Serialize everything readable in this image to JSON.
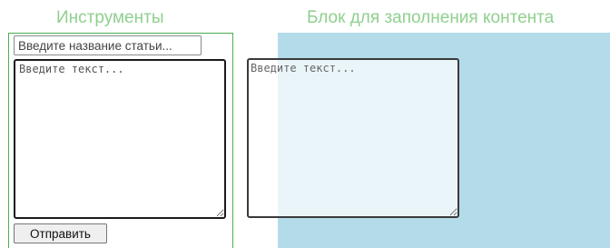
{
  "tools": {
    "heading": "Инструменты",
    "title_placeholder": "Введите название статьи...",
    "text_placeholder": "Введите текст...",
    "submit_label": "Отправить"
  },
  "content": {
    "heading": "Блок для заполнения контента",
    "text_placeholder": "Введите текст..."
  },
  "colors": {
    "heading": "#8fd08f",
    "tools_border": "#4caf50",
    "content_background": "#b4dbea"
  }
}
